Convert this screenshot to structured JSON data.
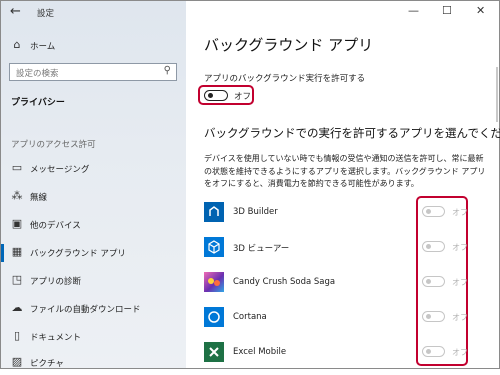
{
  "window": {
    "title": "設定",
    "back_icon": "back-arrow-icon",
    "minimize": "—",
    "maximize": "☐",
    "close": "✕"
  },
  "sidebar": {
    "home": "ホーム",
    "search_placeholder": "設定の検索",
    "privacy_title": "プライバシー",
    "section_title": "アプリのアクセス許可",
    "items": [
      {
        "label": "メッセージング",
        "icon": "message-icon"
      },
      {
        "label": "無線",
        "icon": "radio-icon"
      },
      {
        "label": "他のデバイス",
        "icon": "devices-icon"
      },
      {
        "label": "バックグラウンド アプリ",
        "icon": "background-apps-icon",
        "selected": true
      },
      {
        "label": "アプリの診断",
        "icon": "diagnostics-icon"
      },
      {
        "label": "ファイルの自動ダウンロード",
        "icon": "cloud-download-icon"
      },
      {
        "label": "ドキュメント",
        "icon": "document-icon"
      },
      {
        "label": "ピクチャ",
        "icon": "picture-icon"
      }
    ]
  },
  "main": {
    "title": "バックグラウンド アプリ",
    "master_label": "アプリのバックグラウンド実行を許可する",
    "master_state": "オフ",
    "subheading": "バックグラウンドでの実行を許可するアプリを選んでください",
    "description": "デバイスを使用していない時でも情報の受信や通知の送信を許可し、常に最新の状態を維持できるようにするアプリを選択します。バックグラウンド アプリをオフにすると、消費電力を節約できる可能性があります。",
    "apps": [
      {
        "name": "3D Builder",
        "state": "オフ",
        "icon": "3d-builder-icon",
        "color": "#0063b1"
      },
      {
        "name": "3D ビューアー",
        "state": "オフ",
        "icon": "3d-viewer-icon",
        "color": "#0078d7"
      },
      {
        "name": "Candy Crush Soda Saga",
        "state": "オフ",
        "icon": "candy-crush-icon",
        "color": "#6a2fb0"
      },
      {
        "name": "Cortana",
        "state": "オフ",
        "icon": "cortana-icon",
        "color": "#0078d7"
      },
      {
        "name": "Excel Mobile",
        "state": "オフ",
        "icon": "excel-icon",
        "color": "#1e7145"
      }
    ]
  },
  "colors": {
    "accent": "#0067b8",
    "highlight": "#c2002f"
  }
}
